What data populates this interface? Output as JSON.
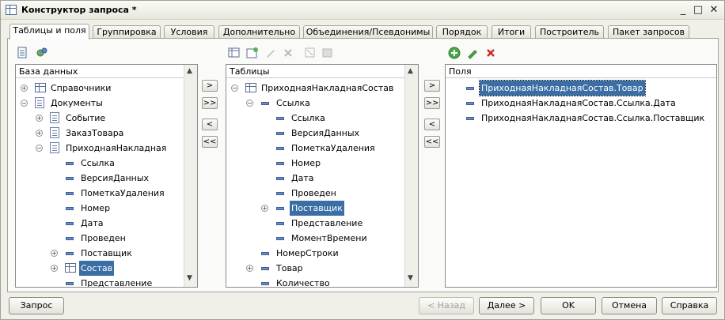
{
  "window": {
    "title": "Конструктор запроса *",
    "controls": [
      "_",
      "□",
      "✕"
    ]
  },
  "tabs": [
    "Таблицы и поля",
    "Группировка",
    "Условия",
    "Дополнительно",
    "Объединения/Псевдонимы",
    "Порядок",
    "Итоги",
    "Построитель",
    "Пакет запросов"
  ],
  "database_panel": {
    "header": "База данных",
    "rows": [
      "Справочники",
      "Документы",
      "Событие",
      "ЗаказТовара",
      "ПриходнаяНакладная",
      "Ссылка",
      "ВерсияДанных",
      "ПометкаУдаления",
      "Номер",
      "Дата",
      "Проведен",
      "Поставщик",
      "Состав",
      "Представление"
    ]
  },
  "tables_panel": {
    "header": "Таблицы",
    "rows": [
      "ПриходнаяНакладнаяСостав",
      "Ссылка",
      "Ссылка",
      "ВерсияДанных",
      "ПометкаУдаления",
      "Номер",
      "Дата",
      "Проведен",
      "Поставщик",
      "Представление",
      "МоментВремени",
      "НомерСтроки",
      "Товар",
      "Количество"
    ]
  },
  "fields_panel": {
    "header": "Поля",
    "rows": [
      "ПриходнаяНакладнаяСостав.Товар",
      "ПриходнаяНакладнаяСостав.Ссылка.Дата",
      "ПриходнаяНакладнаяСостав.Ссылка.Поставщик"
    ]
  },
  "transfer_buttons": [
    ">",
    ">>",
    "<",
    "<<"
  ],
  "footer": {
    "query": "Запрос",
    "back": "< Назад",
    "next": "Далее >",
    "ok": "OK",
    "cancel": "Отмена",
    "help": "Справка"
  },
  "icons": [
    "table-icon",
    "settings-icon",
    "add-icon",
    "edit-icon",
    "delete-icon"
  ]
}
